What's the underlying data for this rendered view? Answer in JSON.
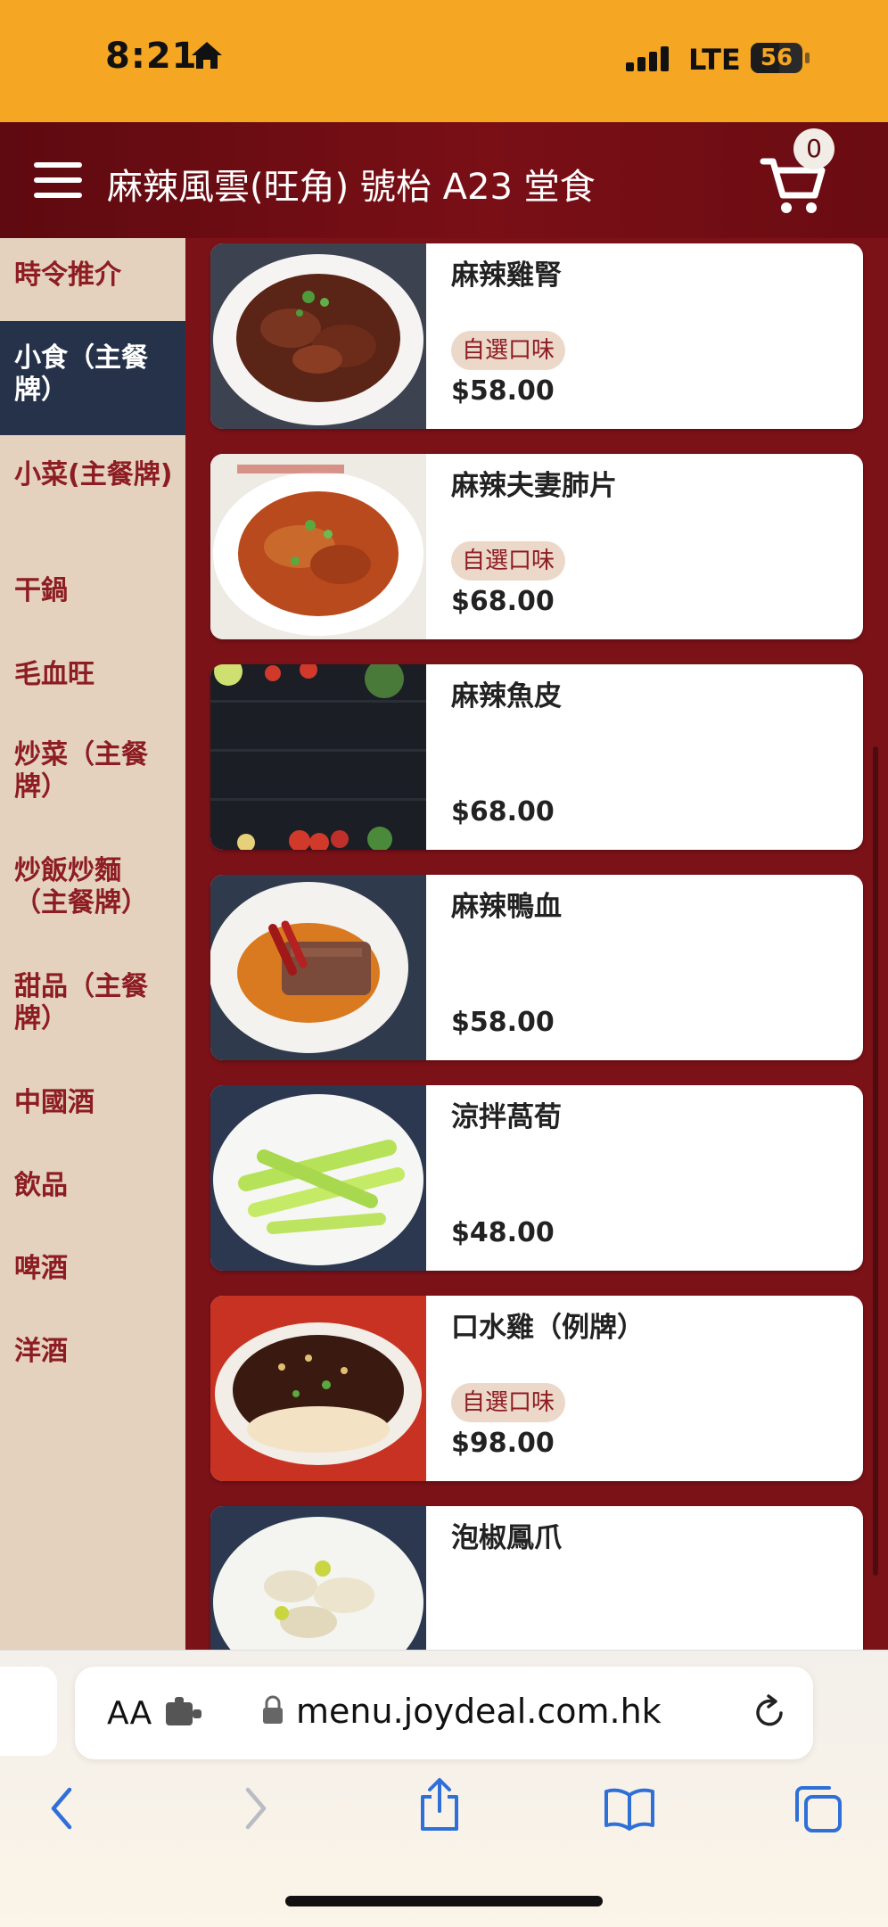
{
  "status_bar": {
    "time": "8:21",
    "network": "LTE",
    "battery": "56",
    "battery_level_fraction": 0.56
  },
  "header": {
    "title": "麻辣風雲(旺角) 號枱 A23 堂食",
    "cart_count": "0"
  },
  "sidebar": {
    "items": [
      {
        "label": "時令推介",
        "active": false
      },
      {
        "label": "小食（主餐牌）",
        "active": true
      },
      {
        "label": "小菜(主餐牌)",
        "active": false
      },
      {
        "label": "干鍋",
        "active": false
      },
      {
        "label": "毛血旺",
        "active": false
      },
      {
        "label": "炒菜（主餐牌）",
        "active": false
      },
      {
        "label": "炒飯炒麵（主餐牌）",
        "active": false
      },
      {
        "label": "甜品（主餐牌）",
        "active": false
      },
      {
        "label": "中國酒",
        "active": false
      },
      {
        "label": "飲品",
        "active": false
      },
      {
        "label": "啤酒",
        "active": false
      },
      {
        "label": "洋酒",
        "active": false
      }
    ]
  },
  "menu_items": [
    {
      "name": "麻辣雞腎",
      "tag": "自選口味",
      "price": "$58.00"
    },
    {
      "name": "麻辣夫妻肺片",
      "tag": "自選口味",
      "price": "$68.00"
    },
    {
      "name": "麻辣魚皮",
      "tag": "",
      "price": "$68.00"
    },
    {
      "name": "麻辣鴨血",
      "tag": "",
      "price": "$58.00"
    },
    {
      "name": "涼拌萵荀",
      "tag": "",
      "price": "$48.00"
    },
    {
      "name": "口水雞（例牌）",
      "tag": "自選口味",
      "price": "$98.00"
    },
    {
      "name": "泡椒鳳爪",
      "tag": "",
      "price": ""
    }
  ],
  "browser": {
    "text_size_label": "AA",
    "url": "menu.joydeal.com.hk"
  },
  "colors": {
    "status_bar": "#f5a623",
    "header": "#6a0c12",
    "sidebar_bg": "#e4d2bf",
    "sidebar_active": "#26324a",
    "content_bg": "#7b1218",
    "accent_text": "#8d1d23"
  }
}
